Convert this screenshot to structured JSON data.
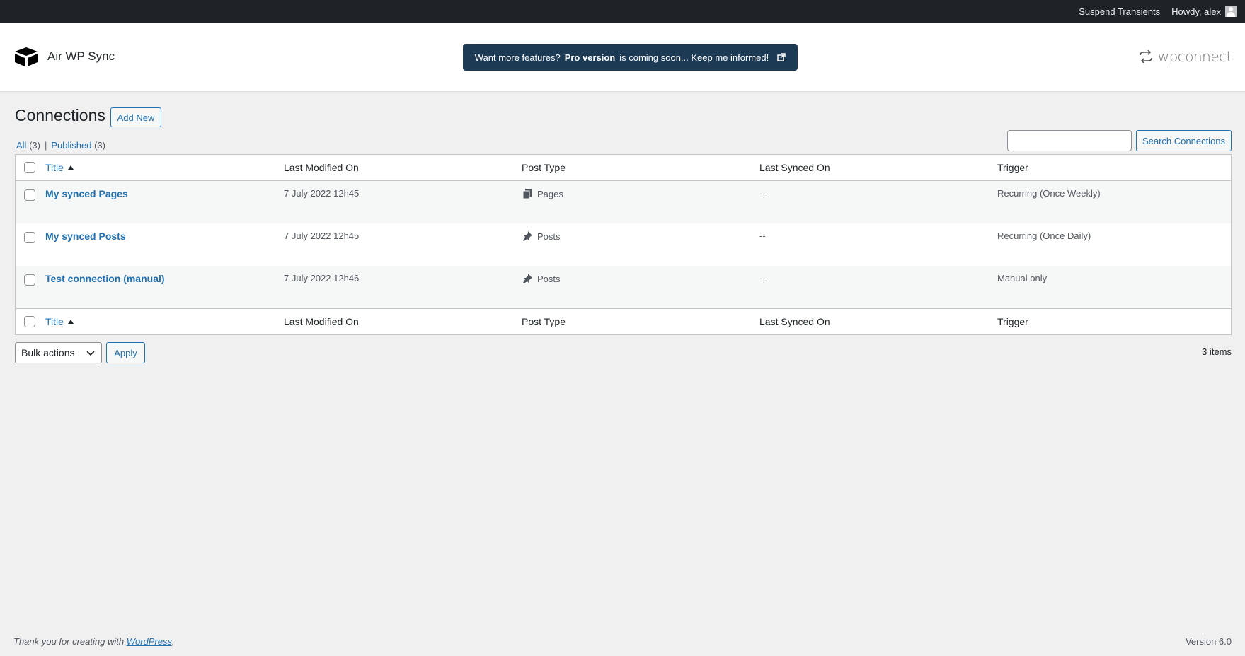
{
  "adminbar": {
    "suspend_transients": "Suspend Transients",
    "howdy": "Howdy, alex"
  },
  "plugin": {
    "title": "Air WP Sync",
    "promo_prefix": "Want more features?",
    "promo_bold": "Pro version",
    "promo_suffix": "is coming soon... Keep me informed!",
    "partner": "wpconnect"
  },
  "page": {
    "title": "Connections",
    "add_new": "Add New"
  },
  "filters": {
    "all_label": "All",
    "all_count": "(3)",
    "published_label": "Published",
    "published_count": "(3)",
    "separator": "|"
  },
  "search": {
    "button": "Search Connections",
    "value": ""
  },
  "table": {
    "columns": {
      "title": "Title",
      "modified": "Last Modified On",
      "type": "Post Type",
      "synced": "Last Synced On",
      "trigger": "Trigger"
    },
    "rows": [
      {
        "title": "My synced Pages",
        "modified": "7 July 2022 12h45",
        "type": "Pages",
        "type_icon": "pages-icon",
        "synced": "--",
        "trigger": "Recurring (Once Weekly)"
      },
      {
        "title": "My synced Posts",
        "modified": "7 July 2022 12h45",
        "type": "Posts",
        "type_icon": "pin-icon",
        "synced": "--",
        "trigger": "Recurring (Once Daily)"
      },
      {
        "title": "Test connection (manual)",
        "modified": "7 July 2022 12h46",
        "type": "Posts",
        "type_icon": "pin-icon",
        "synced": "--",
        "trigger": "Manual only"
      }
    ]
  },
  "bulk": {
    "selected": "Bulk actions",
    "apply": "Apply",
    "items": "3 items"
  },
  "footer": {
    "thanks_prefix": "Thank you for creating with",
    "wordpress": "WordPress",
    "thanks_suffix": ".",
    "version": "Version 6.0"
  },
  "colors": {
    "adminbar_bg": "#1d2327",
    "promo_bg": "#1d3a55",
    "link": "#2271b1",
    "page_bg": "#f0f0f1"
  }
}
